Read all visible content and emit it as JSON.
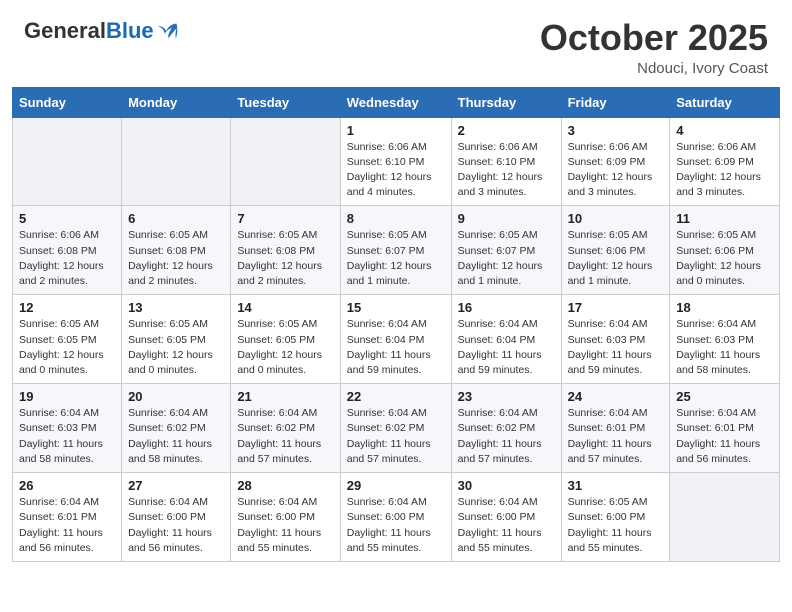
{
  "header": {
    "logo_general": "General",
    "logo_blue": "Blue",
    "title": "October 2025",
    "location": "Ndouci, Ivory Coast"
  },
  "weekdays": [
    "Sunday",
    "Monday",
    "Tuesday",
    "Wednesday",
    "Thursday",
    "Friday",
    "Saturday"
  ],
  "weeks": [
    [
      {
        "day": "",
        "info": ""
      },
      {
        "day": "",
        "info": ""
      },
      {
        "day": "",
        "info": ""
      },
      {
        "day": "1",
        "info": "Sunrise: 6:06 AM\nSunset: 6:10 PM\nDaylight: 12 hours\nand 4 minutes."
      },
      {
        "day": "2",
        "info": "Sunrise: 6:06 AM\nSunset: 6:10 PM\nDaylight: 12 hours\nand 3 minutes."
      },
      {
        "day": "3",
        "info": "Sunrise: 6:06 AM\nSunset: 6:09 PM\nDaylight: 12 hours\nand 3 minutes."
      },
      {
        "day": "4",
        "info": "Sunrise: 6:06 AM\nSunset: 6:09 PM\nDaylight: 12 hours\nand 3 minutes."
      }
    ],
    [
      {
        "day": "5",
        "info": "Sunrise: 6:06 AM\nSunset: 6:08 PM\nDaylight: 12 hours\nand 2 minutes."
      },
      {
        "day": "6",
        "info": "Sunrise: 6:05 AM\nSunset: 6:08 PM\nDaylight: 12 hours\nand 2 minutes."
      },
      {
        "day": "7",
        "info": "Sunrise: 6:05 AM\nSunset: 6:08 PM\nDaylight: 12 hours\nand 2 minutes."
      },
      {
        "day": "8",
        "info": "Sunrise: 6:05 AM\nSunset: 6:07 PM\nDaylight: 12 hours\nand 1 minute."
      },
      {
        "day": "9",
        "info": "Sunrise: 6:05 AM\nSunset: 6:07 PM\nDaylight: 12 hours\nand 1 minute."
      },
      {
        "day": "10",
        "info": "Sunrise: 6:05 AM\nSunset: 6:06 PM\nDaylight: 12 hours\nand 1 minute."
      },
      {
        "day": "11",
        "info": "Sunrise: 6:05 AM\nSunset: 6:06 PM\nDaylight: 12 hours\nand 0 minutes."
      }
    ],
    [
      {
        "day": "12",
        "info": "Sunrise: 6:05 AM\nSunset: 6:05 PM\nDaylight: 12 hours\nand 0 minutes."
      },
      {
        "day": "13",
        "info": "Sunrise: 6:05 AM\nSunset: 6:05 PM\nDaylight: 12 hours\nand 0 minutes."
      },
      {
        "day": "14",
        "info": "Sunrise: 6:05 AM\nSunset: 6:05 PM\nDaylight: 12 hours\nand 0 minutes."
      },
      {
        "day": "15",
        "info": "Sunrise: 6:04 AM\nSunset: 6:04 PM\nDaylight: 11 hours\nand 59 minutes."
      },
      {
        "day": "16",
        "info": "Sunrise: 6:04 AM\nSunset: 6:04 PM\nDaylight: 11 hours\nand 59 minutes."
      },
      {
        "day": "17",
        "info": "Sunrise: 6:04 AM\nSunset: 6:03 PM\nDaylight: 11 hours\nand 59 minutes."
      },
      {
        "day": "18",
        "info": "Sunrise: 6:04 AM\nSunset: 6:03 PM\nDaylight: 11 hours\nand 58 minutes."
      }
    ],
    [
      {
        "day": "19",
        "info": "Sunrise: 6:04 AM\nSunset: 6:03 PM\nDaylight: 11 hours\nand 58 minutes."
      },
      {
        "day": "20",
        "info": "Sunrise: 6:04 AM\nSunset: 6:02 PM\nDaylight: 11 hours\nand 58 minutes."
      },
      {
        "day": "21",
        "info": "Sunrise: 6:04 AM\nSunset: 6:02 PM\nDaylight: 11 hours\nand 57 minutes."
      },
      {
        "day": "22",
        "info": "Sunrise: 6:04 AM\nSunset: 6:02 PM\nDaylight: 11 hours\nand 57 minutes."
      },
      {
        "day": "23",
        "info": "Sunrise: 6:04 AM\nSunset: 6:02 PM\nDaylight: 11 hours\nand 57 minutes."
      },
      {
        "day": "24",
        "info": "Sunrise: 6:04 AM\nSunset: 6:01 PM\nDaylight: 11 hours\nand 57 minutes."
      },
      {
        "day": "25",
        "info": "Sunrise: 6:04 AM\nSunset: 6:01 PM\nDaylight: 11 hours\nand 56 minutes."
      }
    ],
    [
      {
        "day": "26",
        "info": "Sunrise: 6:04 AM\nSunset: 6:01 PM\nDaylight: 11 hours\nand 56 minutes."
      },
      {
        "day": "27",
        "info": "Sunrise: 6:04 AM\nSunset: 6:00 PM\nDaylight: 11 hours\nand 56 minutes."
      },
      {
        "day": "28",
        "info": "Sunrise: 6:04 AM\nSunset: 6:00 PM\nDaylight: 11 hours\nand 55 minutes."
      },
      {
        "day": "29",
        "info": "Sunrise: 6:04 AM\nSunset: 6:00 PM\nDaylight: 11 hours\nand 55 minutes."
      },
      {
        "day": "30",
        "info": "Sunrise: 6:04 AM\nSunset: 6:00 PM\nDaylight: 11 hours\nand 55 minutes."
      },
      {
        "day": "31",
        "info": "Sunrise: 6:05 AM\nSunset: 6:00 PM\nDaylight: 11 hours\nand 55 minutes."
      },
      {
        "day": "",
        "info": ""
      }
    ]
  ]
}
